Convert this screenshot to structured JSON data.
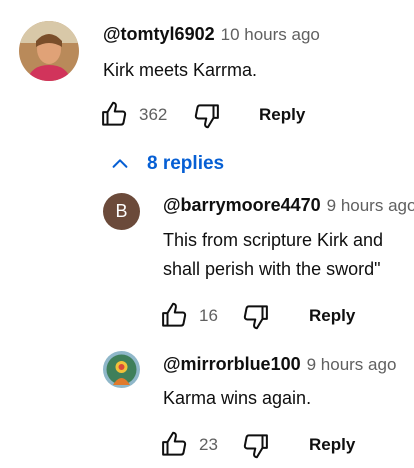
{
  "comment": {
    "author": "@tomtyl6902",
    "time": "10 hours ago",
    "text": "Kirk meets Karrma.",
    "likes": "362",
    "reply_label": "Reply",
    "replies_label": "8 replies"
  },
  "replies": [
    {
      "author": "@barrymoore4470",
      "time": "9 hours ago",
      "avatar_letter": "B",
      "text_lines": [
        "This from scripture Kirk and",
        "shall perish with the sword\""
      ],
      "likes": "16",
      "reply_label": "Reply"
    },
    {
      "author": "@mirrorblue100",
      "time": "9 hours ago",
      "text_lines": [
        "Karma wins again."
      ],
      "likes": "23",
      "reply_label": "Reply"
    }
  ],
  "icons": {
    "like": "thumbs-up-outline",
    "dislike": "thumbs-down-outline",
    "expand": "chevron-up"
  },
  "colors": {
    "link_blue": "#065fd4",
    "secondary_text": "#606060",
    "avatar_b_bg": "#6b4a3a"
  }
}
